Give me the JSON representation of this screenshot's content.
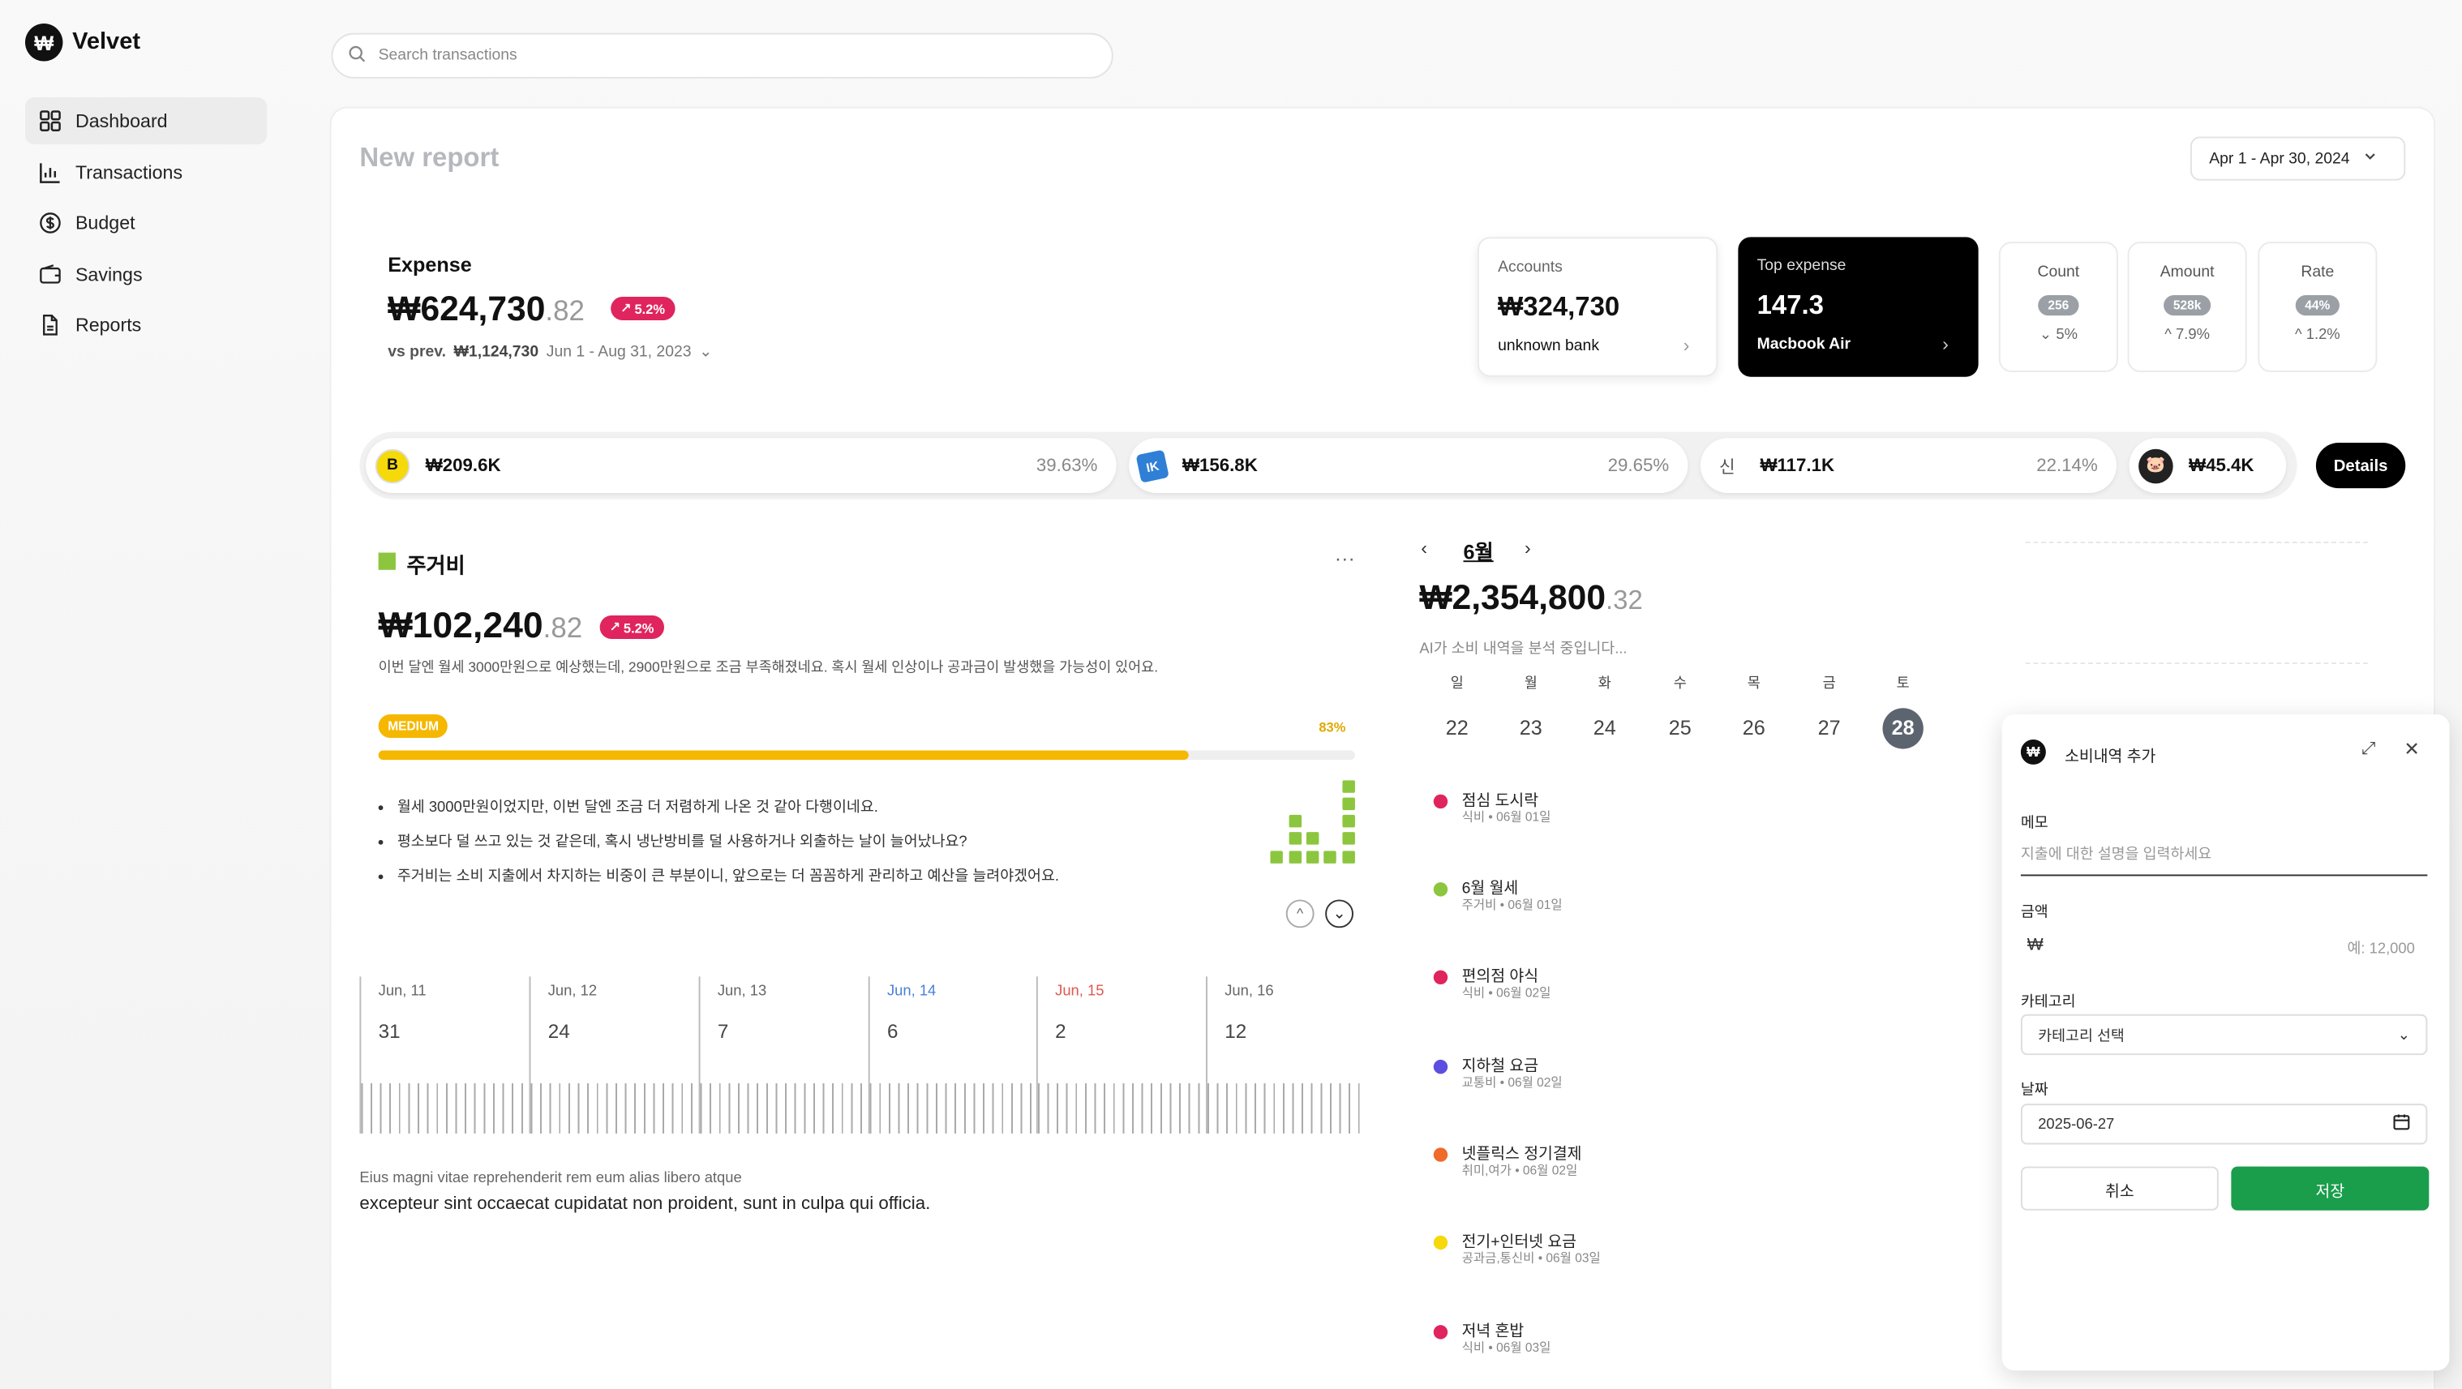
{
  "brand": {
    "logo": "₩",
    "name": "Velvet"
  },
  "nav": [
    {
      "label": "Dashboard",
      "icon": "grid-icon",
      "active": true
    },
    {
      "label": "Transactions",
      "icon": "bar-chart-icon"
    },
    {
      "label": "Budget",
      "icon": "dollar-circle-icon"
    },
    {
      "label": "Savings",
      "icon": "wallet-icon"
    },
    {
      "label": "Reports",
      "icon": "file-icon"
    }
  ],
  "search": {
    "placeholder": "Search transactions"
  },
  "report": {
    "title": "New report",
    "date_range": "Apr 1 - Apr 30, 2024"
  },
  "expense": {
    "label": "Expense",
    "amount_main": "₩624,730",
    "amount_dec": ".82",
    "change": "5.2%",
    "vs_label": "vs prev.",
    "vs_amount": "₩1,124,730",
    "vs_range": "Jun 1 - Aug 31, 2023"
  },
  "accounts_card": {
    "label": "Accounts",
    "value": "₩324,730",
    "sub": "unknown bank"
  },
  "top_expense_card": {
    "label": "Top expense",
    "value": "147.3",
    "sub": "Macbook Air"
  },
  "stats": [
    {
      "label": "Count",
      "pill": "256",
      "change": "5%",
      "dir": "down"
    },
    {
      "label": "Amount",
      "pill": "528k",
      "change": "7.9%",
      "dir": "up"
    },
    {
      "label": "Rate",
      "pill": "44%",
      "change": "1.2%",
      "dir": "up"
    }
  ],
  "merchants": [
    {
      "icon_text": "B",
      "icon_bg": "#f5d90a",
      "value": "₩209.6K",
      "pct": "39.63%"
    },
    {
      "icon_text": "IK",
      "icon_bg": "#2f7fd6",
      "value": "₩156.8K",
      "pct": "29.65%"
    },
    {
      "icon_text": "신",
      "icon_bg": "#ffffff",
      "value": "₩117.1K",
      "pct": "22.14%"
    },
    {
      "icon_text": "🐷",
      "icon_bg": "#222222",
      "value": "₩45.4K",
      "pct": ""
    }
  ],
  "details_button": "Details",
  "category": {
    "name": "주거비",
    "color": "#8cc63f",
    "amount_main": "₩102,240",
    "amount_dec": ".82",
    "change": "5.2%",
    "note": "이번 달엔 월세 3000만원으로 예상했는데, 2900만원으로 조금 부족해졌네요. 혹시 월세 인상이나 공과금이 발생했을 가능성이 있어요.",
    "level": "MEDIUM",
    "progress_pct": "83%",
    "progress": 0.83,
    "bullets": [
      "월세 3000만원이었지만, 이번 달엔 조금 더 저렴하게 나온 것 같아 다행이네요.",
      "평소보다 덜 쓰고 있는 것 같은데, 혹시 냉난방비를 덜 사용하거나 외출하는 날이 늘어났나요?",
      "주거비는 소비 지출에서 차지하는 비중이 큰 부분이니, 앞으로는 더 꼼꼼하게 관리하고 예산을 늘려야겠어요."
    ]
  },
  "days": [
    {
      "label": "Jun, 11",
      "value": "31",
      "color": "#666"
    },
    {
      "label": "Jun, 12",
      "value": "24",
      "color": "#666"
    },
    {
      "label": "Jun, 13",
      "value": "7",
      "color": "#666"
    },
    {
      "label": "Jun, 14",
      "value": "6",
      "color": "#4a7fd6"
    },
    {
      "label": "Jun, 15",
      "value": "2",
      "color": "#e0564f"
    },
    {
      "label": "Jun, 16",
      "value": "12",
      "color": "#666"
    }
  ],
  "footer_text": {
    "line1": "Eius magni vitae reprehenderit rem eum alias libero atque",
    "line2": "excepteur sint occaecat cupidatat non proident, sunt in culpa qui officia."
  },
  "calendar": {
    "month": "6월",
    "total_main": "₩2,354,800",
    "total_dec": ".32",
    "ai_note": "AI가 소비 내역을 분석 중입니다...",
    "weekdays": [
      "일",
      "월",
      "화",
      "수",
      "목",
      "금",
      "토"
    ],
    "dates": [
      "22",
      "23",
      "24",
      "25",
      "26",
      "27",
      "28"
    ],
    "selected_index": 6
  },
  "transactions": [
    {
      "title": "점심 도시락",
      "sub": "식비 • 06월 01일",
      "color": "#e0245e"
    },
    {
      "title": "6월 월세",
      "sub": "주거비 • 06월 01일",
      "color": "#8cc63f"
    },
    {
      "title": "편의점 야식",
      "sub": "식비 • 06월 02일",
      "color": "#e0245e"
    },
    {
      "title": "지하철 요금",
      "sub": "교통비 • 06월 02일",
      "color": "#5b4ee0"
    },
    {
      "title": "넷플릭스 정기결제",
      "sub": "취미,여가 • 06월 02일",
      "color": "#f06a2a"
    },
    {
      "title": "전기+인터넷 요금",
      "sub": "공과금,통신비 • 06월 03일",
      "color": "#f5d90a"
    },
    {
      "title": "저녁 혼밥",
      "sub": "식비 • 06월 03일",
      "color": "#e0245e"
    }
  ],
  "modal": {
    "title": "소비내역 추가",
    "memo_label": "메모",
    "memo_placeholder": "지출에 대한 설명을 입력하세요",
    "amount_label": "금액",
    "currency": "₩",
    "amount_placeholder": "예: 12,000",
    "category_label": "카테고리",
    "category_value": "카테고리 선택",
    "date_label": "날짜",
    "date_value": "2025-06-27",
    "cancel": "취소",
    "save": "저장"
  }
}
